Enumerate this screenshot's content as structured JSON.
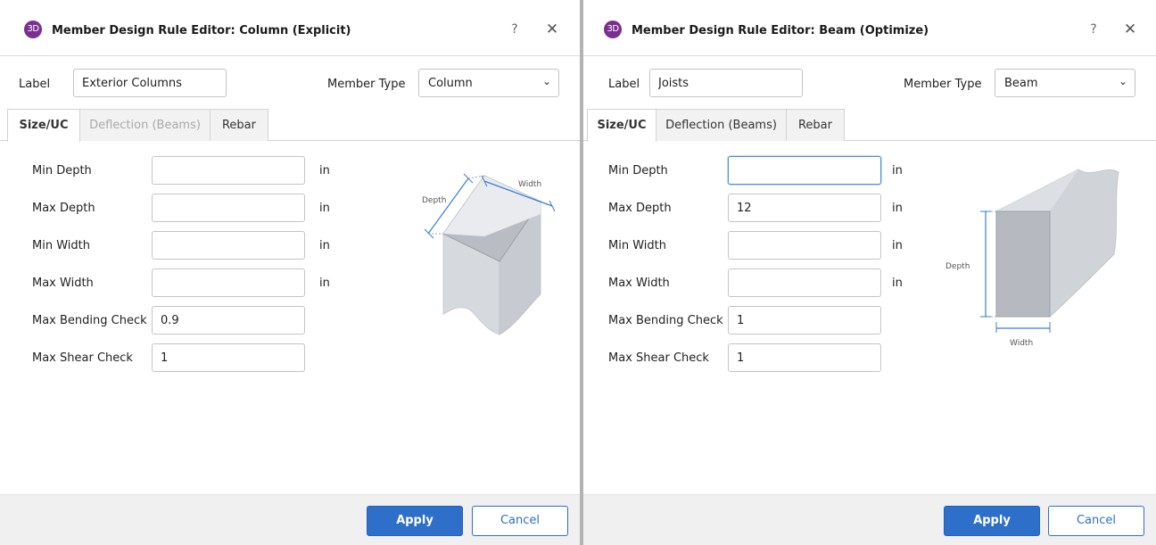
{
  "left": {
    "icon_text": "3D",
    "title": "Member Design Rule Editor: Column (Explicit)",
    "help_glyph": "?",
    "close_glyph": "✕",
    "label_caption": "Label",
    "label_value": "Exterior Columns",
    "member_type_caption": "Member Type",
    "member_type_value": "Column",
    "tabs": [
      "Size/UC",
      "Deflection (Beams)",
      "Rebar"
    ],
    "fields": [
      {
        "label": "Min Depth",
        "value": "",
        "unit": "in"
      },
      {
        "label": "Max Depth",
        "value": "",
        "unit": "in"
      },
      {
        "label": "Min Width",
        "value": "",
        "unit": "in"
      },
      {
        "label": "Max Width",
        "value": "",
        "unit": "in"
      },
      {
        "label": "Max Bending Check",
        "value": "0.9",
        "unit": ""
      },
      {
        "label": "Max Shear Check",
        "value": "1",
        "unit": ""
      }
    ],
    "diagram": {
      "depth_label": "Depth",
      "width_label": "Width"
    },
    "apply_label": "Apply",
    "cancel_label": "Cancel"
  },
  "right": {
    "icon_text": "3D",
    "title": "Member Design Rule Editor: Beam (Optimize)",
    "help_glyph": "?",
    "close_glyph": "✕",
    "label_caption": "Label",
    "label_value": "Joists",
    "member_type_caption": "Member Type",
    "member_type_value": "Beam",
    "tabs": [
      "Size/UC",
      "Deflection (Beams)",
      "Rebar"
    ],
    "fields": [
      {
        "label": "Min Depth",
        "value": "",
        "unit": "in"
      },
      {
        "label": "Max Depth",
        "value": "12",
        "unit": "in"
      },
      {
        "label": "Min Width",
        "value": "",
        "unit": "in"
      },
      {
        "label": "Max Width",
        "value": "",
        "unit": "in"
      },
      {
        "label": "Max Bending Check",
        "value": "1",
        "unit": ""
      },
      {
        "label": "Max Shear Check",
        "value": "1",
        "unit": ""
      }
    ],
    "diagram": {
      "depth_label": "Depth",
      "width_label": "Width"
    },
    "apply_label": "Apply",
    "cancel_label": "Cancel"
  },
  "colors": {
    "accent": "#2d6fc9",
    "app_icon": "#7a2f8f",
    "dimension_lines": "#3b7dd8"
  },
  "icons": {
    "app": "app-3d-icon",
    "help": "help-icon",
    "close": "close-icon",
    "dropdown": "chevron-down-icon"
  }
}
